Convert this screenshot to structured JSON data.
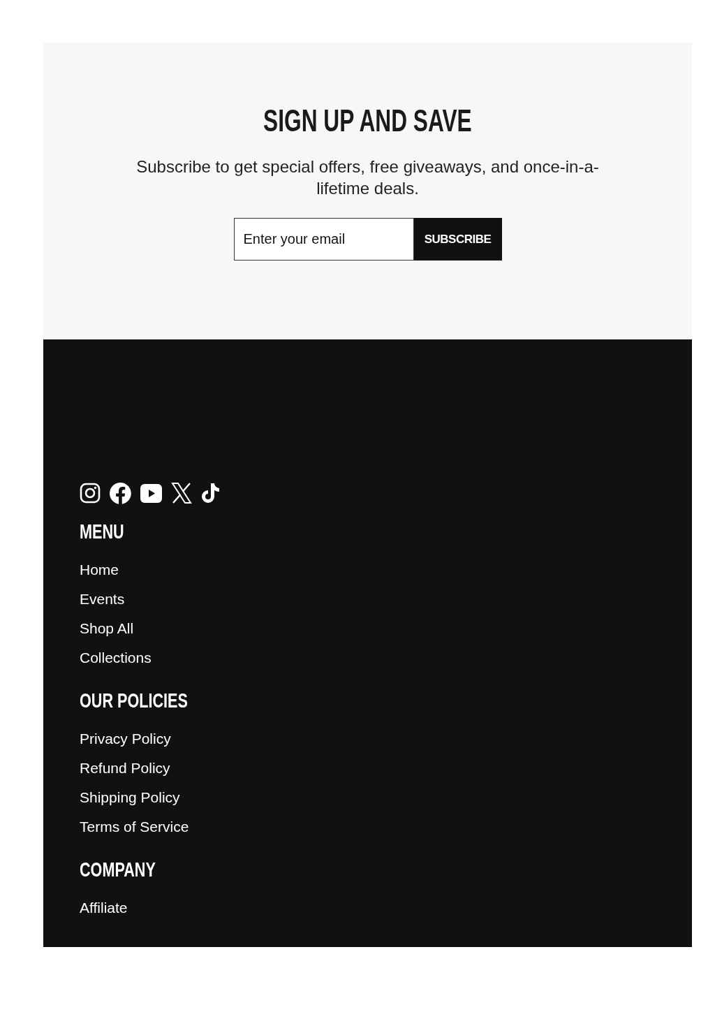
{
  "signup": {
    "title": "SIGN UP AND SAVE",
    "text": "Subscribe to get special offers, free giveaways, and once-in-a-lifetime deals.",
    "email": {
      "placeholder": "Enter your email"
    },
    "button": "SUBSCRIBE"
  },
  "footer": {
    "social": [
      {
        "kind": "camera"
      },
      {
        "kind": "facebook"
      },
      {
        "kind": "play"
      },
      {
        "kind": "x"
      },
      {
        "kind": "note"
      }
    ],
    "sections": [
      {
        "title": "MENU",
        "links": [
          "Home",
          "Events",
          "Shop All",
          "Collections"
        ]
      },
      {
        "title": "OUR POLICIES",
        "links": [
          "Privacy Policy",
          "Refund Policy",
          "Shipping Policy",
          "Terms of Service"
        ]
      },
      {
        "title": "COMPANY",
        "links": [
          "Affiliate"
        ]
      }
    ]
  }
}
